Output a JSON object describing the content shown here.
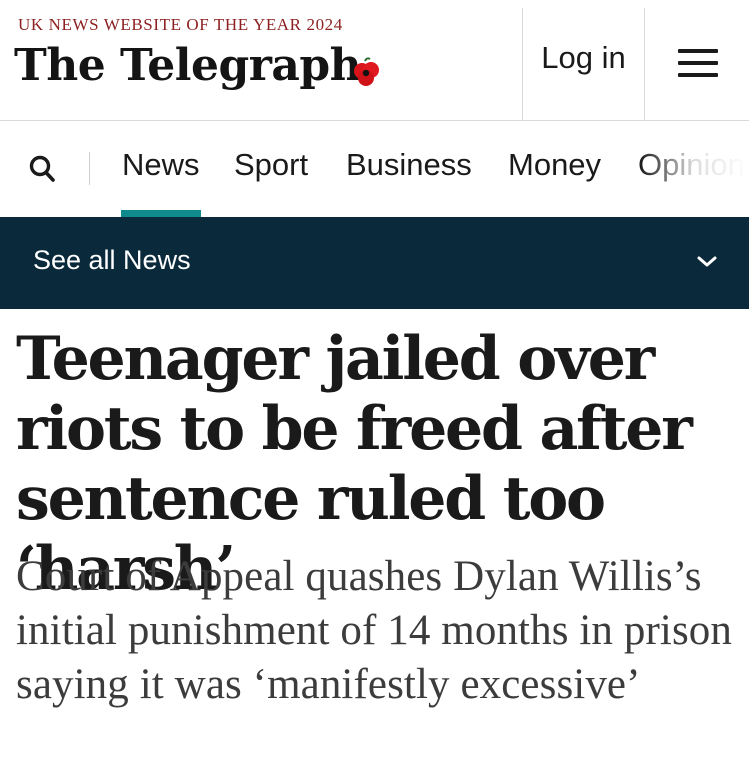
{
  "masthead": {
    "award": "UK NEWS WEBSITE OF THE YEAR 2024",
    "logo": "The Telegraph",
    "login_label": "Log in",
    "menu_icon": "hamburger-menu-icon",
    "poppy_icon": "poppy-icon"
  },
  "nav": {
    "search_icon": "search-icon",
    "items": [
      {
        "label": "News",
        "active": true
      },
      {
        "label": "Sport"
      },
      {
        "label": "Business"
      },
      {
        "label": "Money"
      },
      {
        "label": "Opinion"
      }
    ],
    "accent_color": "#0f8b8d"
  },
  "see_all": {
    "label": "See all News",
    "icon": "chevron-down-icon",
    "background": "#0a2a3c"
  },
  "article": {
    "headline": "Teenager jailed over riots to be freed after sentence ruled too ‘harsh’",
    "standfirst": "Court of Appeal quashes Dylan Willis’s initial punishment of 14 months in prison saying it was ‘manifestly excessive’"
  }
}
